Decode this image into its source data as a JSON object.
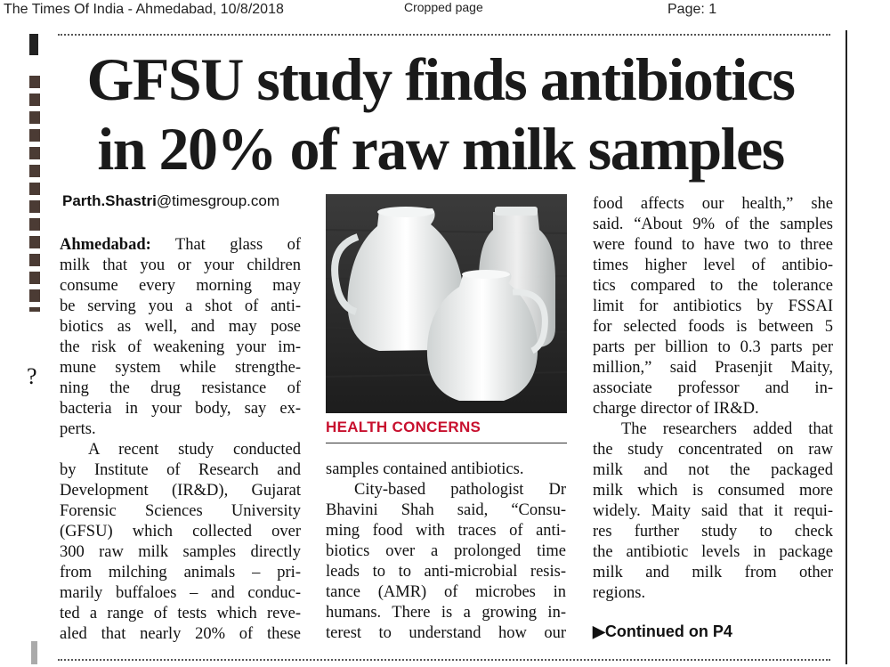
{
  "header": {
    "publication": "The Times Of India - Ahmedabad, 10/8/2018",
    "crop_label": "Cropped page",
    "page": "Page: 1"
  },
  "article": {
    "headline_line1": "GFSU study finds antibiotics",
    "headline_line2": "in 20% of raw milk samples",
    "byline_name": "Parth.Shastri",
    "byline_domain": "@timesgroup.com",
    "dateline": "Ahmedabad:",
    "col1": {
      "p1": [
        "That glass of",
        "milk that you or your children",
        "consume every morning may",
        "be serving you a shot of anti-",
        "biotics as well, and may pose",
        "the risk of weakening your im-",
        "mune system while strengthe-",
        "ning the drug resistance of",
        "bacteria in your body, say ex-",
        "perts."
      ],
      "p2": [
        "A recent study conducted",
        "by Institute of Research and",
        "Development (IR&D), Gujarat",
        "Forensic Sciences University",
        "(GFSU) which collected over",
        "300 raw milk samples directly",
        "from milching animals – pri-",
        "marily buffaloes – and conduc-",
        "ted a range of tests which reve-",
        "aled that nearly 20% of these"
      ]
    },
    "col2": {
      "p1": [
        "samples contained antibiotics."
      ],
      "p2": [
        "City-based pathologist Dr",
        "Bhavini Shah said, “Consu-",
        "ming food with traces of anti-",
        "biotics over a prolonged time",
        "leads to to anti-microbial resis-",
        "tance (AMR) of microbes in",
        "humans. There is a growing in-",
        "terest to understand how our"
      ]
    },
    "col3": {
      "p1": [
        "food affects our health,” she",
        "said. “About 9% of the samples",
        "were found to have two to three",
        "times higher level of antibio-",
        "tics compared to the tolerance",
        "limit for antibiotics by FSSAI",
        "for selected foods is between 5",
        "parts per billion to 0.3 parts per",
        "million,” said Prasenjit Maity,",
        "associate professor and in-",
        "charge director of IR&D."
      ],
      "p2": [
        "The researchers added that",
        "the study concentrated on raw",
        "milk and not the packaged",
        "milk which is consumed more",
        "widely. Maity said that it requi-",
        "res further study to check",
        "the antibiotic levels in package",
        "milk and milk from other",
        "regions."
      ]
    },
    "photo_caption": "HEALTH CONCERNS",
    "continued": "Continued on P4"
  }
}
